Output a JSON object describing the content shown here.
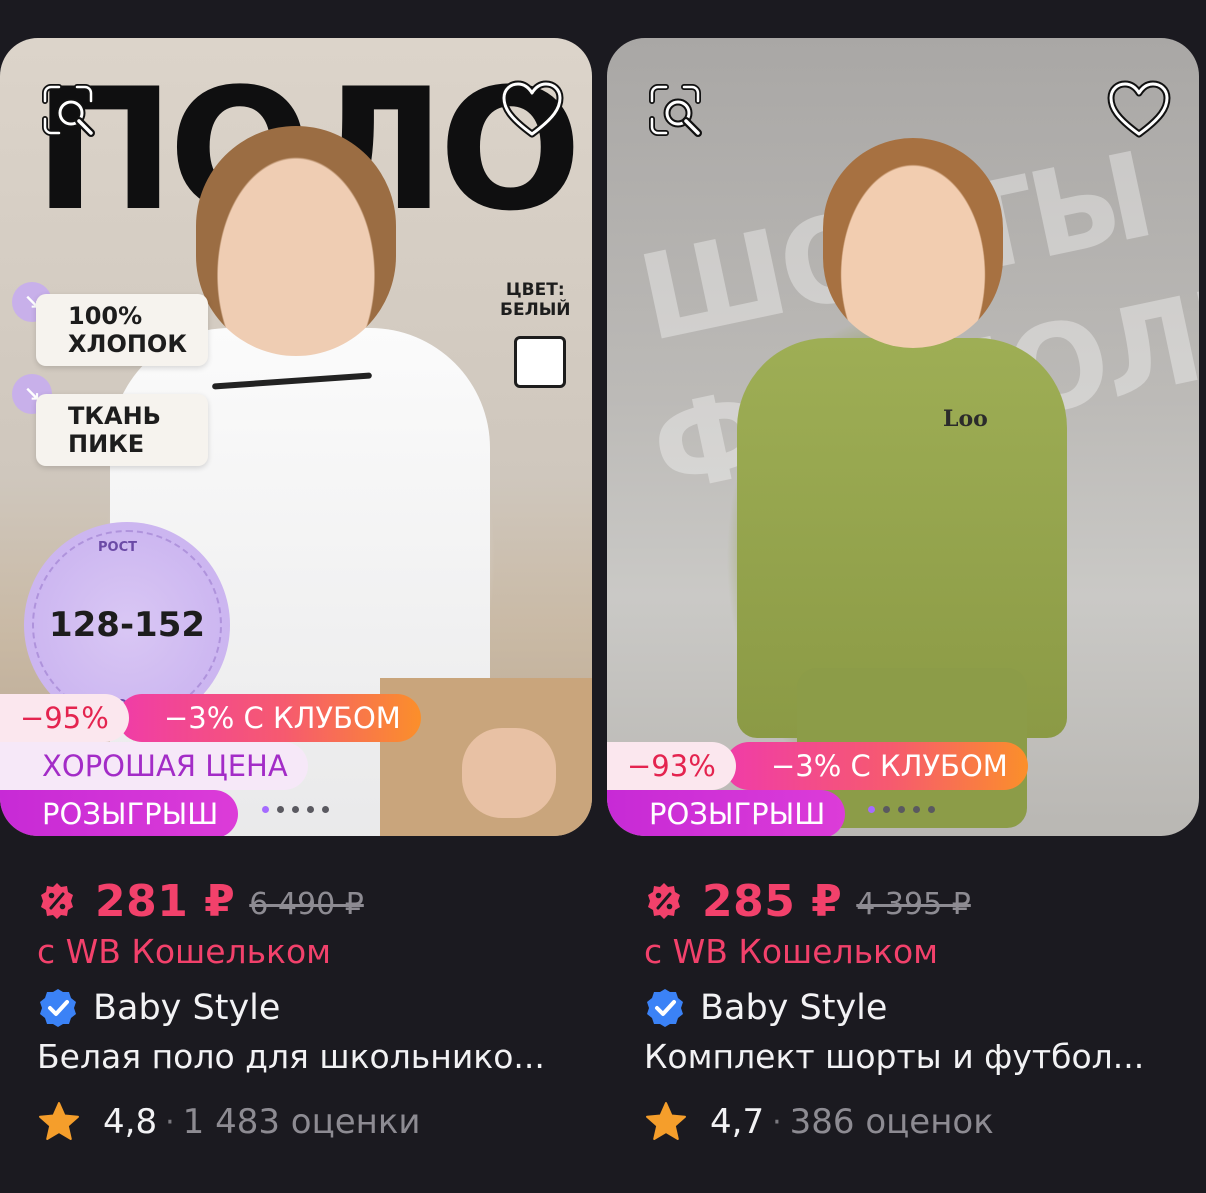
{
  "products": [
    {
      "image": {
        "headline": "ПОЛО",
        "features": [
          "100%\nХЛОПОК",
          "ТКАНЬ\nПИКЕ"
        ],
        "color_label": "ЦВЕТ:\nБЕЛЫЙ",
        "size_range": "128-152",
        "size_word": "РОСТ"
      },
      "badges": {
        "discount": "−95%",
        "club": "−3% С КЛУБОМ",
        "good_price": "ХОРОШАЯ ЦЕНА",
        "lottery": "РОЗЫГРЫШ"
      },
      "price": "281 ₽",
      "old_price": "6 490 ₽",
      "wallet_note": "с WB Кошельком",
      "brand": "Baby Style",
      "title": "Белая поло для школьнико...",
      "rating": "4,8",
      "reviews": "1 483 оценки"
    },
    {
      "image": {
        "ghost_text_1": "ШОРТЫ",
        "ghost_text_2": "ФУТБОЛКА",
        "shirt_logo": "Loo"
      },
      "badges": {
        "discount": "−93%",
        "club": "−3% С КЛУБОМ",
        "lottery": "РОЗЫГРЫШ"
      },
      "price": "285 ₽",
      "old_price": "4 395 ₽",
      "wallet_note": "с WB Кошельком",
      "brand": "Baby Style",
      "title": "Комплект шорты и футбол...",
      "rating": "4,7",
      "reviews": "386 оценок"
    }
  ],
  "icons": {
    "search": "image-search-icon",
    "favorite": "heart-icon",
    "discount": "discount-badge-icon",
    "verified": "verified-check-icon",
    "star": "star-icon"
  },
  "colors": {
    "background": "#1b1a20",
    "price": "#f2416b",
    "club_gradient_start": "#f03ca8",
    "club_gradient_end": "#fb8f2a",
    "lottery": "#c72ad6",
    "verified": "#3b82f6",
    "star": "#f59e2b",
    "dot_active": "#a56bff"
  }
}
